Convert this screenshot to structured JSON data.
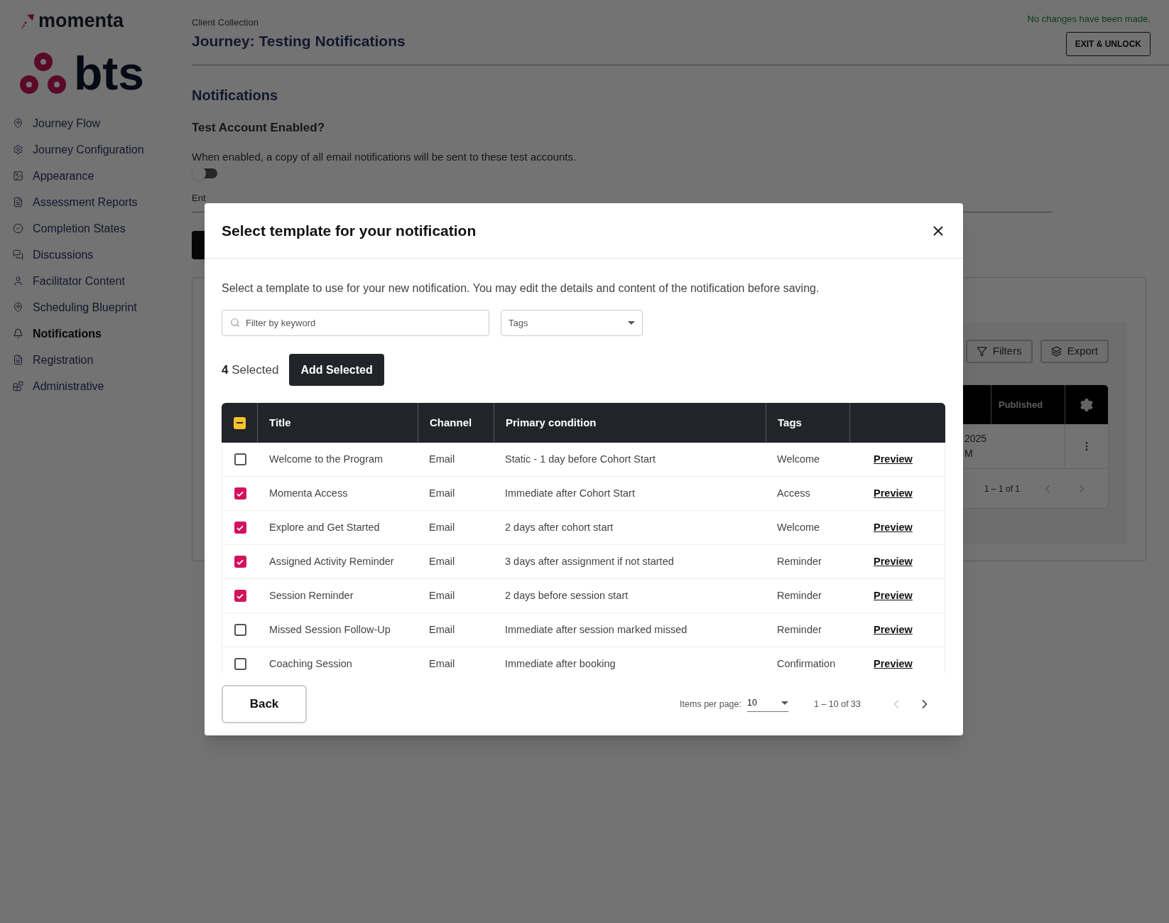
{
  "brand": {
    "name": "momenta",
    "partner": "bts"
  },
  "sidebar": {
    "items": [
      {
        "label": "Journey Flow",
        "selected": false
      },
      {
        "label": "Journey Configuration",
        "selected": false
      },
      {
        "label": "Appearance",
        "selected": false
      },
      {
        "label": "Assessment Reports",
        "selected": false
      },
      {
        "label": "Completion States",
        "selected": false
      },
      {
        "label": "Discussions",
        "selected": false
      },
      {
        "label": "Facilitator Content",
        "selected": false
      },
      {
        "label": "Scheduling Blueprint",
        "selected": false
      },
      {
        "label": "Notifications",
        "selected": true
      },
      {
        "label": "Registration",
        "selected": false
      },
      {
        "label": "Administrative",
        "selected": false
      }
    ]
  },
  "header": {
    "breadcrumb": "Client Collection",
    "title": "Journey: Testing Notifications",
    "status": "No changes have been made.",
    "exit_button": "EXIT & UNLOCK"
  },
  "page": {
    "heading": "Notifications",
    "test_account": {
      "label": "Test Account Enabled?",
      "description": "When enabled, a copy of all email notifications will be sent to these test accounts.",
      "on": false
    },
    "email_field": {
      "placeholder": "Ent"
    },
    "toolbar": {
      "filters": "Filters",
      "export": "Export"
    },
    "table": {
      "columns": [
        "Published"
      ],
      "rows": [
        {
          "date_line_1": "2025",
          "date_line_2": "M"
        }
      ],
      "pagination": "1 – 1 of 1"
    }
  },
  "modal": {
    "title": "Select template for your notification",
    "description": "Select a template to use for your new notification. You may edit the details and content of the notification before saving.",
    "search": {
      "placeholder": "Filter by keyword"
    },
    "tags_select": {
      "placeholder": "Tags"
    },
    "selected_count": "4",
    "selected_label": "Selected",
    "add_button": "Add Selected",
    "select_all": {
      "indeterminate": true
    },
    "columns": [
      "Title",
      "Channel",
      "Primary condition",
      "Tags"
    ],
    "rows": [
      {
        "title": "Welcome to the Program",
        "channel": "Email",
        "condition": "Static - 1 day before Cohort Start",
        "tag": "Welcome",
        "action": "Preview",
        "checked": false
      },
      {
        "title": "Momenta Access",
        "channel": "Email",
        "condition": "Immediate after Cohort Start",
        "tag": "Access",
        "action": "Preview",
        "checked": true
      },
      {
        "title": "Explore and Get Started",
        "channel": "Email",
        "condition": "2 days after cohort start",
        "tag": "Welcome",
        "action": "Preview",
        "checked": true
      },
      {
        "title": "Assigned Activity Reminder",
        "channel": "Email",
        "condition": "3 days after assignment if not started",
        "tag": "Reminder",
        "action": "Preview",
        "checked": true
      },
      {
        "title": "Session Reminder",
        "channel": "Email",
        "condition": "2 days before session start",
        "tag": "Reminder",
        "action": "Preview",
        "checked": true
      },
      {
        "title": "Missed Session Follow-Up",
        "channel": "Email",
        "condition": "Immediate after session marked missed",
        "tag": "Reminder",
        "action": "Preview",
        "checked": false
      },
      {
        "title": "Coaching Session",
        "channel": "Email",
        "condition": "Immediate after booking",
        "tag": "Confirmation",
        "action": "Preview",
        "checked": false
      }
    ],
    "back_button": "Back",
    "items_per_page_label": "Items per page:",
    "items_per_page": "10",
    "range": "1 – 10 of 33"
  }
}
